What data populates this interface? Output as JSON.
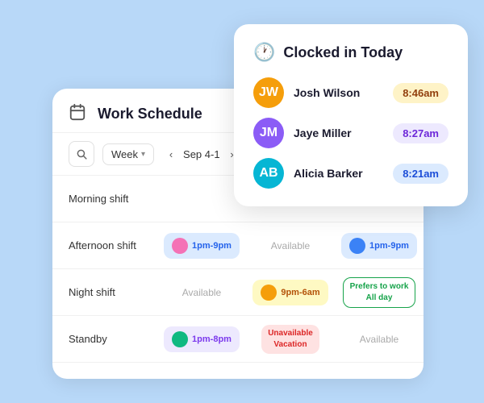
{
  "workSchedule": {
    "title": "Work Schedule",
    "toolbar": {
      "weekLabel": "Week",
      "dateRange": "Sep 4-1",
      "searchIcon": "🔍",
      "prevIcon": "‹",
      "nextIcon": "›"
    },
    "rows": [
      {
        "label": "Morning shift",
        "cells": []
      },
      {
        "label": "Afternoon shift",
        "cells": [
          {
            "type": "chip-blue",
            "time": "1pm-9pm",
            "avatarColor": "blue"
          },
          {
            "type": "available",
            "text": "Available"
          },
          {
            "type": "chip-blue",
            "time": "1pm-9pm",
            "avatarColor": "pink"
          }
        ]
      },
      {
        "label": "Night shift",
        "cells": [
          {
            "type": "available",
            "text": "Available"
          },
          {
            "type": "chip-yellow",
            "time": "9pm-6am",
            "avatarColor": "amber"
          },
          {
            "type": "prefers",
            "line1": "Prefers to work",
            "line2": "All day"
          }
        ]
      },
      {
        "label": "Standby",
        "cells": [
          {
            "type": "chip-purple",
            "time": "1pm-8pm",
            "avatarColor": "green"
          },
          {
            "type": "unavailable",
            "line1": "Unavailable",
            "line2": "Vacation"
          },
          {
            "type": "available",
            "text": "Available"
          }
        ]
      }
    ]
  },
  "clockedIn": {
    "title": "Clocked in Today",
    "clockIcon": "🕐",
    "people": [
      {
        "name": "Josh Wilson",
        "time": "8:46am",
        "badgeClass": "time-yellow",
        "initials": "JW",
        "avatarClass": "avatar-jw"
      },
      {
        "name": "Jaye Miller",
        "time": "8:27am",
        "badgeClass": "time-purple",
        "initials": "JM",
        "avatarClass": "avatar-jm"
      },
      {
        "name": "Alicia Barker",
        "time": "8:21am",
        "badgeClass": "time-blue",
        "initials": "AB",
        "avatarClass": "avatar-ab"
      }
    ]
  }
}
